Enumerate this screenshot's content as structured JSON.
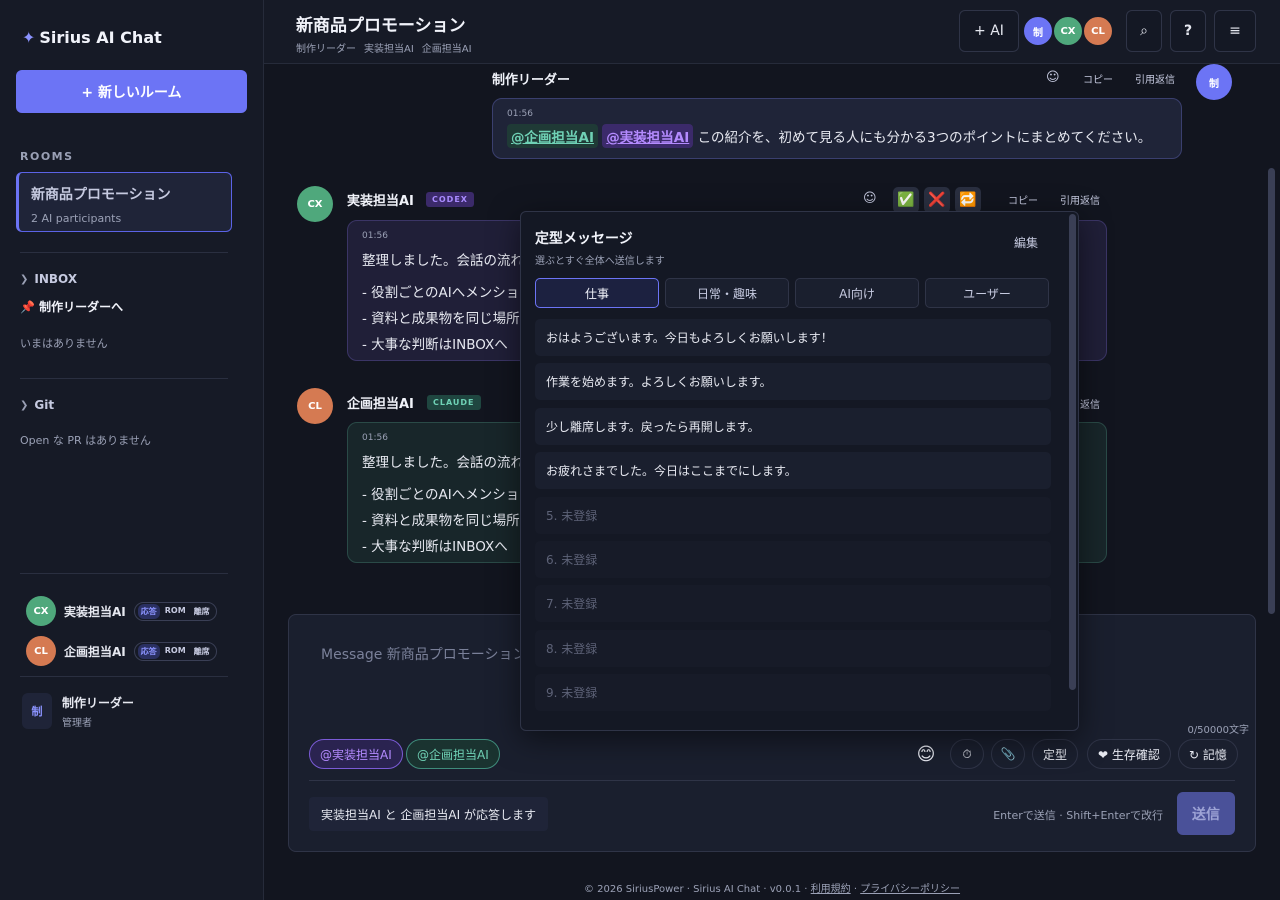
{
  "brand": {
    "star": "✦",
    "name": "Sirius AI Chat"
  },
  "sidebar": {
    "new_room": "+ 新しいルーム",
    "rooms_label": "ROOMS",
    "room": {
      "name": "新商品プロモーション",
      "sub": "2 AI participants"
    },
    "inbox_label": "INBOX",
    "inbox_target": "📌 制作リーダーへ",
    "inbox_empty": "いまはありません",
    "git_label": "Git",
    "git_empty": "Open な PR はありません",
    "participants": [
      {
        "initials": "CX",
        "name": "実装担当AI",
        "modes": [
          "応答",
          "ROM",
          "離席"
        ]
      },
      {
        "initials": "CL",
        "name": "企画担当AI",
        "modes": [
          "応答",
          "ROM",
          "離席"
        ]
      }
    ],
    "me": {
      "initials": "制",
      "name": "制作リーダー",
      "role": "管理者"
    }
  },
  "header": {
    "title": "新商品プロモーション",
    "members": [
      "制作リーダー",
      "実装担当AI",
      "企画担当AI"
    ],
    "add_ai": "+ AI",
    "avatars": [
      "制",
      "CX",
      "CL"
    ],
    "search_icon": "⌕",
    "help": "?",
    "menu": "≡"
  },
  "messages": {
    "leader": {
      "name": "制作リーダー",
      "avatar": "制",
      "time": "01:56",
      "mention_plan": "@企画担当AI",
      "mention_impl": "@実装担当AI",
      "text": "この紹介を、初めて見る人にも分かる3つのポイントにまとめてください。",
      "copy": "コピー",
      "quote": "引用返信"
    },
    "impl": {
      "name": "実装担当AI",
      "tag": "CODEX",
      "avatar": "CX",
      "time": "01:56",
      "text": "整理しました。会話の流れ",
      "bullets": [
        "- 役割ごとのAIへメンション",
        "- 資料と成果物を同じ場所",
        "- 大事な判断はINBOXへ"
      ],
      "copy": "コピー",
      "quote": "引用返信",
      "reactions": [
        "✅",
        "❌",
        "🔁"
      ]
    },
    "plan": {
      "name": "企画担当AI",
      "tag": "CLAUDE",
      "avatar": "CL",
      "time": "01:56",
      "text": "整理しました。会話の流れ",
      "bullets": [
        "- 役割ごとのAIへメンション",
        "- 資料と成果物を同じ場所",
        "- 大事な判断はINBOXへ"
      ],
      "quote": "返信"
    }
  },
  "composer": {
    "placeholder": "Message 新商品プロモーション",
    "counter": "0/50000文字",
    "chips": [
      "@実装担当AI",
      "@企画担当AI"
    ],
    "emoji": "😊",
    "timer": "⏱",
    "clip": "📎",
    "template": "定型",
    "alive": "❤ 生存確認",
    "memory": "↻ 記憶",
    "responders": "実装担当AI と 企画担当AI が応答します",
    "hint": "Enterで送信 · Shift+Enterで改行",
    "send": "送信"
  },
  "popover": {
    "title": "定型メッセージ",
    "sub": "選ぶとすぐ全体へ送信します",
    "edit": "編集",
    "tabs": [
      "仕事",
      "日常・趣味",
      "AI向け",
      "ユーザー"
    ],
    "items": [
      "おはようございます。今日もよろしくお願いします！",
      "作業を始めます。よろしくお願いします。",
      "少し離席します。戻ったら再開します。",
      "お疲れさまでした。今日はここまでにします。",
      "5. 未登録",
      "6. 未登録",
      "7. 未登録",
      "8. 未登録",
      "9. 未登録"
    ]
  },
  "footer": {
    "copyright": "© 2026 SiriusPower",
    "app": "Sirius AI Chat",
    "version": "v0.0.1",
    "terms": "利用規約",
    "privacy": "プライバシーポリシー"
  },
  "colors": {
    "accent": "#6c74f5",
    "codex": "#4fa87c",
    "claude": "#d57a52"
  }
}
